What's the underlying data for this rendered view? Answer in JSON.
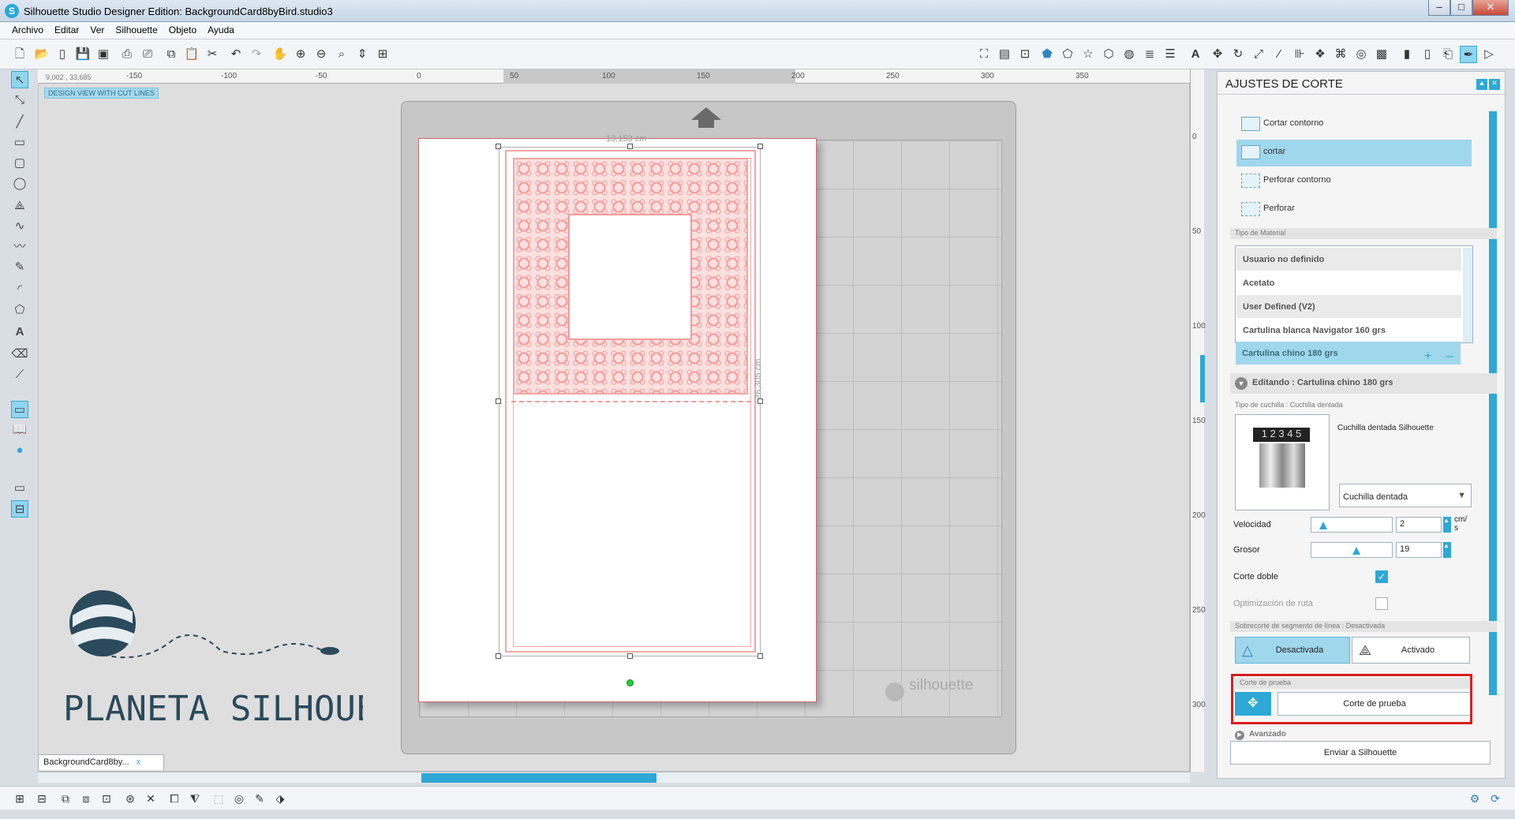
{
  "window": {
    "title": "Silhouette Studio Designer Edition: BackgroundCard8byBird.studio3",
    "minimize": "–",
    "maximize": "□",
    "close": "✕"
  },
  "menu": [
    "Archivo",
    "Editar",
    "Ver",
    "Silhouette",
    "Objeto",
    "Ayuda"
  ],
  "ruler": {
    "coords": "9,002 , 33,685",
    "h_ticks": [
      "-150",
      "-100",
      "-50",
      "0",
      "50",
      "100",
      "150",
      "200",
      "250",
      "300",
      "350"
    ],
    "v_ticks": [
      "0",
      "50",
      "100",
      "150",
      "200",
      "250",
      "300"
    ]
  },
  "canvas": {
    "view_tag": "DESIGN VIEW WITH CUT LINES",
    "width_dim": "13,153 cm",
    "height_dim": "26,305 cm",
    "watermark": "silhouette"
  },
  "document_tab": {
    "label": "BackgroundCard8by...",
    "close": "x"
  },
  "logo": {
    "text": "PLANETA SILHOUETTE"
  },
  "panel": {
    "title": "AJUSTES DE CORTE",
    "cut_modes": [
      {
        "label": "Cortar contorno",
        "selected": false
      },
      {
        "label": "cortar",
        "selected": true
      },
      {
        "label": "Perforar contorno",
        "selected": false
      },
      {
        "label": "Perforar",
        "selected": false
      }
    ],
    "material_header": "Tipo de Material",
    "materials": [
      {
        "label": "Usuario no definido",
        "selected": false
      },
      {
        "label": "Acetato",
        "selected": false
      },
      {
        "label": "User Defined (V2)",
        "selected": false
      },
      {
        "label": "Cartulina blanca Navigator 160 grs",
        "selected": false
      },
      {
        "label": "Cartulina chino 180 grs",
        "selected": true
      }
    ],
    "add": "+",
    "remove": "–",
    "editing": "Editando : Cartulina chino 180 grs",
    "blade_header": "Tipo de cuchilla : Cuchilla dentada",
    "blade_name": "Cuchilla dentada Silhouette",
    "blade_numbers": "1 2 3 4 5",
    "blade_select": "Cuchilla dentada",
    "speed_label": "Velocidad",
    "speed_value": "2",
    "speed_unit": "cm/\ns",
    "thickness_label": "Grosor",
    "thickness_value": "19",
    "double_cut_label": "Corte doble",
    "double_cut": true,
    "path_opt_label": "Optimización de ruta",
    "path_opt": false,
    "overcut_header": "Sobrecorte de segmento de línea : Desactivada",
    "overcut_off": "Desactivada",
    "overcut_on": "Activado",
    "test_header": "Corte de prueba",
    "test_button": "Corte de prueba",
    "advanced": "Avanzado",
    "send_button": "Enviar a Silhouette"
  },
  "colors": {
    "accent": "#2ea8d6",
    "cut_line": "#f29b9b",
    "highlight": "#d91f1f"
  }
}
